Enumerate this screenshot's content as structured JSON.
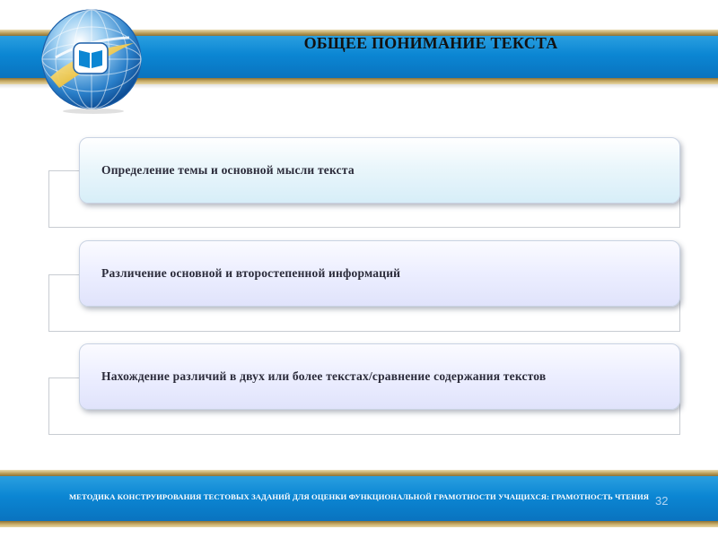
{
  "header": {
    "title": "ОБЩЕЕ ПОНИМАНИЕ ТЕКСТА"
  },
  "logo": {
    "icon": "globe-book-icon",
    "colors": {
      "globe": "#1a6fc0",
      "ring": "#f2c94c",
      "book": "#0b86d3"
    }
  },
  "items": [
    {
      "label": "Определение темы и основной мысли текста"
    },
    {
      "label": "Различение основной и второстепенной информаций"
    },
    {
      "label": "Нахождение различий в двух или более текстах/сравнение содержания текстов"
    }
  ],
  "footer": {
    "text": "МЕТОДИКА КОНСТРУИРОВАНИЯ ТЕСТОВЫХ ЗАДАНИЙ ДЛЯ ОЦЕНКИ ФУНКЦИОНАЛЬНОЙ ГРАМОТНОСТИ УЧАЩИХСЯ: ГРАМОТНОСТЬ ЧТЕНИЯ",
    "slide_number": "32"
  },
  "colors": {
    "band_blue": "#0b86d3",
    "band_gold": "#b79a55",
    "card_blue": "#d7eef8",
    "card_lavender": "#e0e3fb",
    "text": "#2b2b3a"
  }
}
